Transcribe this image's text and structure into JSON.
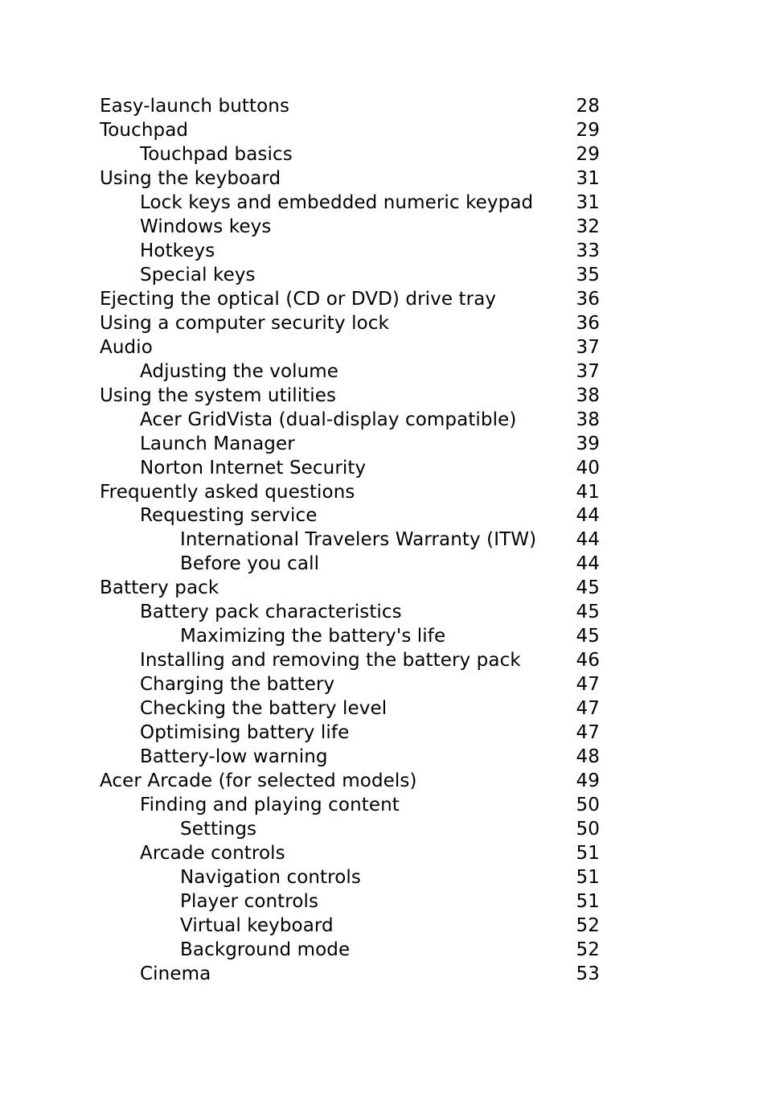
{
  "toc": [
    {
      "title": "Easy-launch buttons",
      "page": "28",
      "level": 0
    },
    {
      "title": "Touchpad",
      "page": "29",
      "level": 0
    },
    {
      "title": "Touchpad basics",
      "page": "29",
      "level": 1
    },
    {
      "title": "Using the keyboard",
      "page": "31",
      "level": 0
    },
    {
      "title": "Lock keys and embedded numeric keypad",
      "page": "31",
      "level": 1
    },
    {
      "title": "Windows keys",
      "page": "32",
      "level": 1
    },
    {
      "title": "Hotkeys",
      "page": "33",
      "level": 1
    },
    {
      "title": "Special keys",
      "page": "35",
      "level": 1
    },
    {
      "title": "Ejecting the optical (CD or DVD) drive tray",
      "page": "36",
      "level": 0
    },
    {
      "title": "Using a computer security lock",
      "page": "36",
      "level": 0
    },
    {
      "title": "Audio",
      "page": "37",
      "level": 0
    },
    {
      "title": "Adjusting the volume",
      "page": "37",
      "level": 1
    },
    {
      "title": "Using the system utilities",
      "page": "38",
      "level": 0
    },
    {
      "title": "Acer GridVista (dual-display compatible)",
      "page": "38",
      "level": 1
    },
    {
      "title": "Launch Manager",
      "page": "39",
      "level": 1
    },
    {
      "title": "Norton Internet Security",
      "page": "40",
      "level": 1
    },
    {
      "title": "Frequently asked questions",
      "page": "41",
      "level": 0
    },
    {
      "title": "Requesting service",
      "page": "44",
      "level": 1
    },
    {
      "title": "International Travelers Warranty (ITW)",
      "page": "44",
      "level": 2
    },
    {
      "title": "Before you call",
      "page": "44",
      "level": 2
    },
    {
      "title": "Battery pack",
      "page": "45",
      "level": 0
    },
    {
      "title": "Battery pack characteristics",
      "page": "45",
      "level": 1
    },
    {
      "title": "Maximizing the battery's life",
      "page": "45",
      "level": 2
    },
    {
      "title": "Installing and removing the battery pack",
      "page": "46",
      "level": 1
    },
    {
      "title": "Charging the battery",
      "page": "47",
      "level": 1
    },
    {
      "title": "Checking the battery level",
      "page": "47",
      "level": 1
    },
    {
      "title": "Optimising battery life",
      "page": "47",
      "level": 1
    },
    {
      "title": "Battery-low warning",
      "page": "48",
      "level": 1
    },
    {
      "title": "Acer Arcade (for selected models)",
      "page": "49",
      "level": 0
    },
    {
      "title": "Finding and playing content",
      "page": "50",
      "level": 1
    },
    {
      "title": "Settings",
      "page": "50",
      "level": 2
    },
    {
      "title": "Arcade controls",
      "page": "51",
      "level": 1
    },
    {
      "title": "Navigation controls",
      "page": "51",
      "level": 2
    },
    {
      "title": "Player controls",
      "page": "51",
      "level": 2
    },
    {
      "title": "Virtual keyboard",
      "page": "52",
      "level": 2
    },
    {
      "title": "Background mode",
      "page": "52",
      "level": 2
    },
    {
      "title": "Cinema",
      "page": "53",
      "level": 1
    }
  ]
}
